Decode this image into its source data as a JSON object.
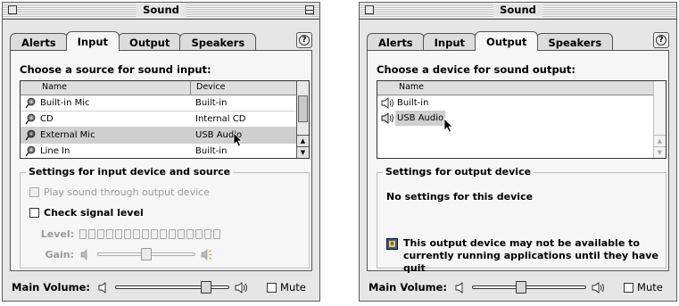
{
  "windows": [
    {
      "title": "Sound",
      "tabs": [
        {
          "label": "Alerts",
          "active": false
        },
        {
          "label": "Input",
          "active": true
        },
        {
          "label": "Output",
          "active": false
        },
        {
          "label": "Speakers",
          "active": false
        }
      ],
      "help_label": "?",
      "heading": "Choose a source for sound input:",
      "list": {
        "columns": [
          "Name",
          "Device"
        ],
        "rows": [
          {
            "name": "Built-in Mic",
            "device": "Built-in",
            "selected": false
          },
          {
            "name": "CD",
            "device": "Internal CD",
            "selected": false
          },
          {
            "name": "External Mic",
            "device": "USB Audio",
            "selected": true
          },
          {
            "name": "Line In",
            "device": "Built-in",
            "selected": false
          }
        ]
      },
      "group_title": "Settings for input device and source",
      "play_through_label": "Play sound through output device",
      "check_signal_label": "Check signal level",
      "level_label": "Level:",
      "gain_label": "Gain:",
      "gain_fraction": 0.5,
      "main_volume_label": "Main Volume:",
      "main_volume_fraction": 0.83,
      "mute_label": "Mute"
    },
    {
      "title": "Sound",
      "tabs": [
        {
          "label": "Alerts",
          "active": false
        },
        {
          "label": "Input",
          "active": false
        },
        {
          "label": "Output",
          "active": true
        },
        {
          "label": "Speakers",
          "active": false
        }
      ],
      "help_label": "?",
      "heading": "Choose a device for sound output:",
      "list": {
        "columns": [
          "Name"
        ],
        "rows": [
          {
            "name": "Built-in",
            "selected": false
          },
          {
            "name": "USB Audio",
            "selected": true
          }
        ]
      },
      "group_title": "Settings for output device",
      "no_settings_text": "No settings for this device",
      "warning_text": "This output device may not be available to currently running applications until they have quit",
      "main_volume_label": "Main Volume:",
      "main_volume_fraction": 0.42,
      "mute_label": "Mute"
    }
  ],
  "colors": {
    "window_bg": "#e6e6e6",
    "panel_bg": "#f6f6f6",
    "selected_row": "#cfcfcf",
    "disabled_text": "#9a9a9a"
  },
  "icons": {
    "input_source": "microphone-icon",
    "output_device": "speaker-icon",
    "warning": "warning-icon",
    "volume_low": "speaker-low-icon",
    "volume_high": "speaker-high-icon"
  }
}
